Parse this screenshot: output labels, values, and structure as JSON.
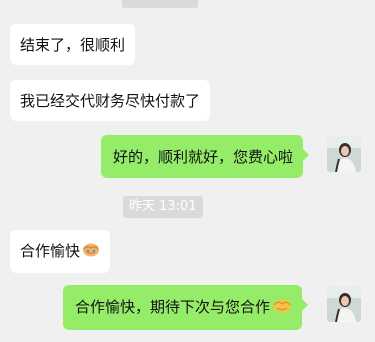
{
  "messages": [
    {
      "side": "left",
      "text": "结束了，很顺利"
    },
    {
      "side": "left",
      "text": "我已经交代财务尽快付款了"
    },
    {
      "side": "right",
      "text": "好的，顺利就好，您费心啦"
    },
    {
      "side": "left",
      "text": "合作愉快",
      "emoji": "handshake-emoji"
    },
    {
      "side": "right",
      "text": "合作愉快，期待下次与您合作",
      "emoji": "handshake-emoji"
    }
  ],
  "timestamp": "昨天 13:01"
}
